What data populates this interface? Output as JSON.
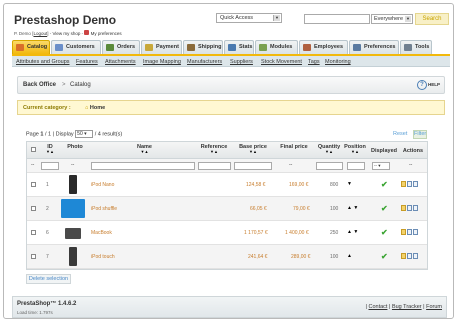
{
  "header": {
    "brand": "Prestashop Demo",
    "user_name": "P. Demo",
    "logout": "Logout",
    "view_shop": "View my shop",
    "preferences": "My preferences",
    "quick_access": "Quick Access",
    "search_scope": "Everywhere",
    "search_button": "Search"
  },
  "tabs": [
    {
      "label": "Catalog",
      "active": true,
      "color": "#d96f2a"
    },
    {
      "label": "Customers",
      "color": "#6b8fc9"
    },
    {
      "label": "Orders",
      "color": "#5a8a3a"
    },
    {
      "label": "Payment",
      "color": "#c8a83a"
    },
    {
      "label": "Shipping",
      "color": "#8a6a3a"
    },
    {
      "label": "Stats",
      "color": "#4a7ab0"
    },
    {
      "label": "Modules",
      "color": "#7aa050"
    },
    {
      "label": "Employees",
      "color": "#b06040"
    },
    {
      "label": "Preferences",
      "color": "#5a7aa0"
    },
    {
      "label": "Tools",
      "color": "#708090"
    }
  ],
  "subtabs": [
    "Attributes and Groups",
    "Features",
    "Attachments",
    "Image Mapping",
    "Manufacturers",
    "Suppliers",
    "Stock Movement",
    "Tags",
    "Monitoring"
  ],
  "breadcrumb": {
    "root": "Back Office",
    "sep": ">",
    "current": "Catalog",
    "help": "HELP"
  },
  "category": {
    "label": "Current category :",
    "value": "Home"
  },
  "pager": {
    "page_label": "Page",
    "page": "1",
    "of": "/ 1",
    "display_label": "| Display",
    "per_page": "50",
    "result": "/ 4 result(s)"
  },
  "filter": {
    "reset": "Reset",
    "filter": "Filter"
  },
  "columns": {
    "id": "ID",
    "photo": "Photo",
    "name": "Name",
    "reference": "Reference",
    "base_price": "Base price",
    "final_price": "Final price",
    "quantity": "Quantity",
    "position": "Position",
    "displayed": "Displayed",
    "actions": "Actions",
    "yes_no": "--",
    "dash": "--"
  },
  "products": [
    {
      "id": "1",
      "name": "iPod Nano",
      "reference": "",
      "base_price": "124,58 €",
      "final_price": "169,00 €",
      "quantity": "800",
      "position": "▼",
      "thumb": "#2a2a2a"
    },
    {
      "id": "2",
      "name": "iPod shuffle",
      "reference": "",
      "base_price": "66,05 €",
      "final_price": "79,00 €",
      "quantity": "100",
      "position": "▲ ▼",
      "thumb": "#1e88d6"
    },
    {
      "id": "6",
      "name": "MacBook",
      "reference": "",
      "base_price": "1 170,57 €",
      "final_price": "1 400,00 €",
      "quantity": "250",
      "position": "▲ ▼",
      "thumb": "#4a4a4a"
    },
    {
      "id": "7",
      "name": "iPod touch",
      "reference": "",
      "base_price": "241,64 €",
      "final_price": "289,00 €",
      "quantity": "100",
      "position": "▲",
      "thumb": "#3a3a3a"
    }
  ],
  "delete_selection": "Delete selection",
  "footer": {
    "version": "PrestaShop™ 1.4.6.2",
    "load_time": "Load time: 1.797s",
    "contact": "Contact",
    "bug_tracker": "Bug Tracker",
    "forum": "Forum"
  }
}
